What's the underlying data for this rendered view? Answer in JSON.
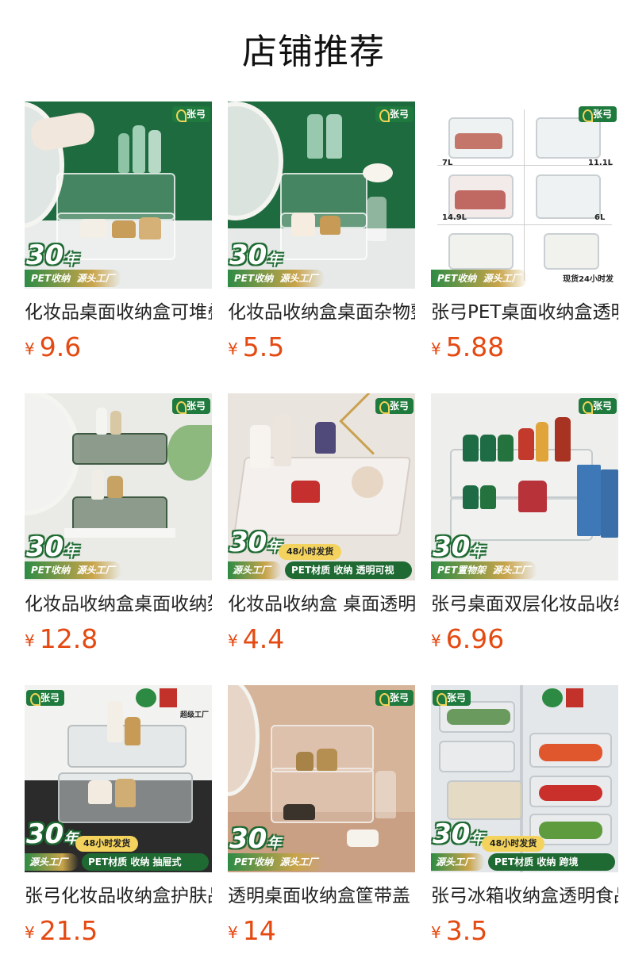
{
  "page": {
    "title": "店铺推荐"
  },
  "colors": {
    "price": "#e44a12",
    "brand_green": "#1f7a3d"
  },
  "products": [
    {
      "name": "化妆品桌面收纳盒可堆叠",
      "currency": "¥",
      "price": "9.6",
      "image": {
        "brand": "张弓",
        "badge": "30",
        "badge_unit": "年",
        "tags": [
          "PET收纳",
          "源头工厂"
        ]
      }
    },
    {
      "name": "化妆品收纳盒桌面杂物整理",
      "currency": "¥",
      "price": "5.5",
      "image": {
        "brand": "张弓",
        "badge": "30",
        "badge_unit": "年",
        "tags": [
          "PET收纳",
          "源头工厂"
        ]
      }
    },
    {
      "name": "张弓PET桌面收纳盒透明",
      "currency": "¥",
      "price": "5.88",
      "image": {
        "brand": "张弓",
        "sizes": [
          "7L",
          "11.1L",
          "14.9L",
          "6L"
        ],
        "tags": [
          "PET收纳",
          "源头工厂"
        ],
        "note": "现货24小时发"
      }
    },
    {
      "name": "化妆品收纳盒桌面收纳架",
      "currency": "¥",
      "price": "12.8",
      "image": {
        "brand": "张弓",
        "badge": "30",
        "badge_unit": "年",
        "tags": [
          "PET收纳",
          "源头工厂"
        ]
      }
    },
    {
      "name": "化妆品收纳盒 桌面透明",
      "currency": "¥",
      "price": "4.4",
      "image": {
        "brand": "张弓",
        "badge": "30",
        "badge_unit": "年",
        "ship": "48小时发货",
        "tags": [
          "源头工厂",
          "PET材质 收纳 透明可视"
        ]
      }
    },
    {
      "name": "张弓桌面双层化妆品收纳",
      "currency": "¥",
      "price": "6.96",
      "image": {
        "brand": "张弓",
        "badge": "30",
        "badge_unit": "年",
        "tags": [
          "PET置物架",
          "源头工厂"
        ]
      }
    },
    {
      "name": "张弓化妆品收纳盒护肤品",
      "currency": "¥",
      "price": "21.5",
      "image": {
        "brand": "张弓",
        "badge": "30",
        "badge_unit": "年",
        "ship": "48小时发货",
        "tags": [
          "源头工厂",
          "PET材质 收纳 抽屉式"
        ],
        "cert": "超级工厂"
      }
    },
    {
      "name": "透明桌面收纳盒筐带盖",
      "currency": "¥",
      "price": "14",
      "image": {
        "brand": "张弓",
        "badge": "30",
        "badge_unit": "年",
        "tags": [
          "PET收纳",
          "源头工厂"
        ]
      }
    },
    {
      "name": "张弓冰箱收纳盒透明食品",
      "currency": "¥",
      "price": "3.5",
      "image": {
        "brand": "张弓",
        "badge": "30",
        "badge_unit": "年",
        "ship": "48小时发货",
        "tags": [
          "源头工厂",
          "PET材质 收纳 跨境"
        ]
      }
    }
  ]
}
